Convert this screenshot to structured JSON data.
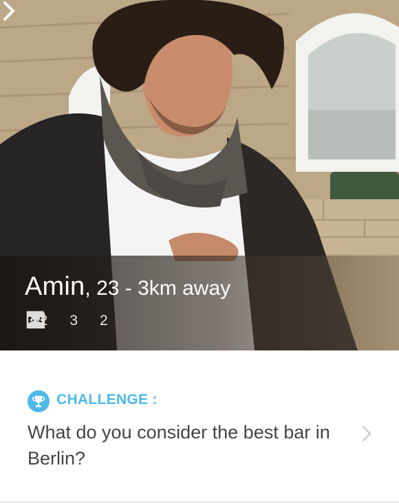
{
  "profile": {
    "name": "Amin",
    "separator": ",",
    "age_distance": " 23 - 3km away",
    "photo_description_icon": "profile-photo"
  },
  "stats": [
    {
      "icon": "person-icon",
      "value": "12"
    },
    {
      "icon": "book-icon",
      "value": "3"
    },
    {
      "icon": "calendar-icon",
      "value": "2"
    }
  ],
  "challenge": {
    "label": "CHALLENGE :",
    "question": "What do you consider the best bar in Berlin?",
    "icon": "trophy-icon"
  },
  "colors": {
    "accent": "#4fb9ec",
    "question_text": "#444444",
    "overlay_text": "#ffffff",
    "arrow": "#cccccc"
  }
}
